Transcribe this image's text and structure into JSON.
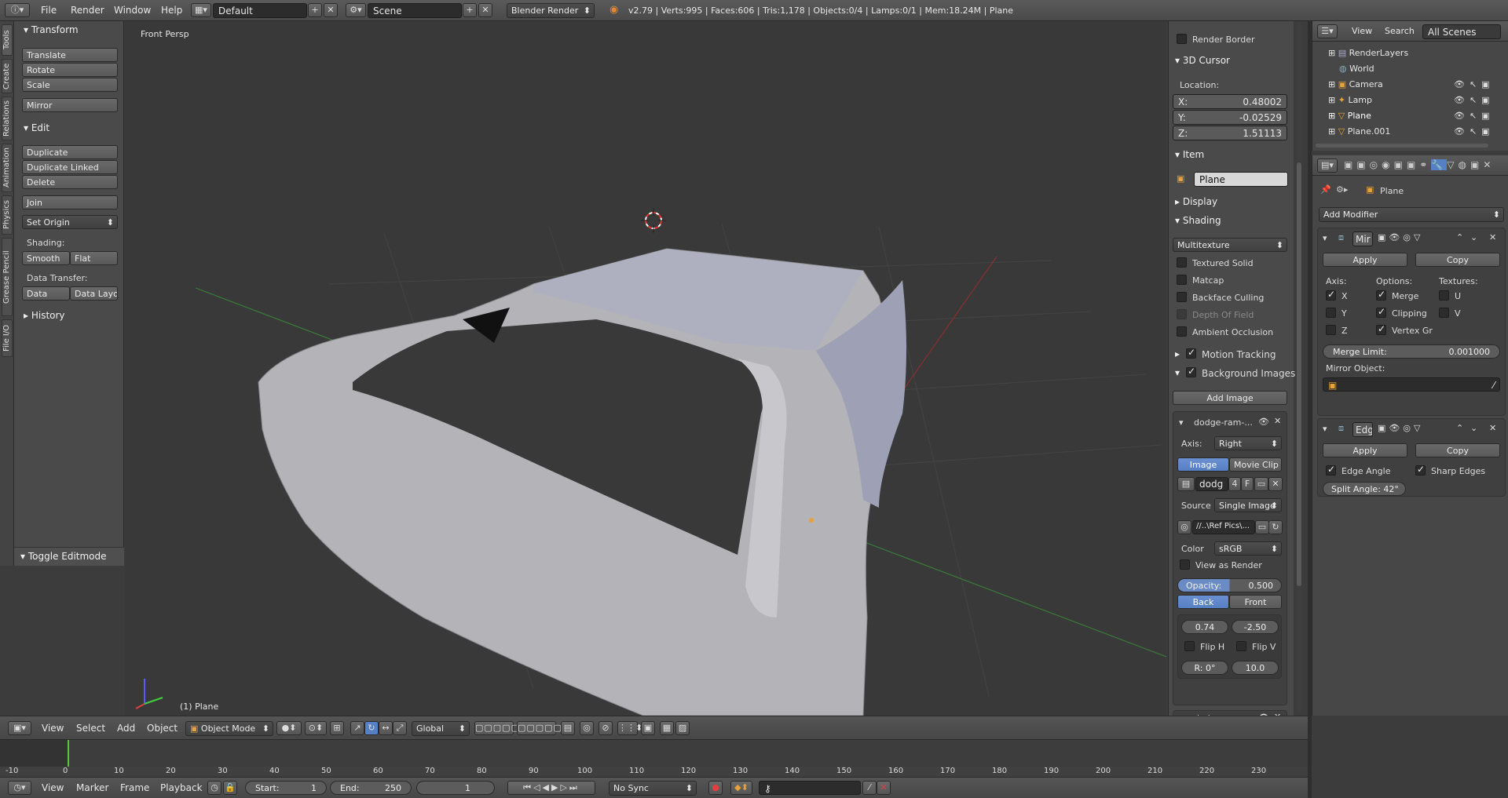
{
  "topbar": {
    "menus": [
      "File",
      "Render",
      "Window",
      "Help"
    ],
    "layout": "Default",
    "scene": "Scene",
    "engine": "Blender Render",
    "stats": "v2.79 | Verts:995 | Faces:606 | Tris:1,178 | Objects:0/4 | Lamps:0/1 | Mem:18.24M | Plane"
  },
  "tabs": [
    "Tools",
    "Create",
    "Relations",
    "Animation",
    "Physics",
    "Grease Pencil",
    "File I/O"
  ],
  "toolshelf": {
    "transform_title": "Transform",
    "translate": "Translate",
    "rotate": "Rotate",
    "scale": "Scale",
    "mirror": "Mirror",
    "edit_title": "Edit",
    "duplicate": "Duplicate",
    "duplicate_linked": "Duplicate Linked",
    "delete": "Delete",
    "join": "Join",
    "set_origin": "Set Origin",
    "shading_label": "Shading:",
    "smooth": "Smooth",
    "flat": "Flat",
    "data_transfer_label": "Data Transfer:",
    "data": "Data",
    "data_layo": "Data Layo",
    "history_title": "History",
    "toggle_editmode": "Toggle Editmode"
  },
  "viewport": {
    "view_name": "Front Persp",
    "object_label": "(1) Plane"
  },
  "npanel": {
    "render_border": "Render Border",
    "cursor_title": "3D Cursor",
    "location_label": "Location:",
    "x_label": "X:",
    "x_value": "0.48002",
    "y_label": "Y:",
    "y_value": "-0.02529",
    "z_label": "Z:",
    "z_value": "1.51113",
    "item_title": "Item",
    "item_name": "Plane",
    "display_title": "Display",
    "shading_title": "Shading",
    "shading_mode": "Multitexture",
    "textured_solid": "Textured Solid",
    "matcap": "Matcap",
    "backface_culling": "Backface Culling",
    "depth_of_field": "Depth Of Field",
    "ambient_occlusion": "Ambient Occlusion",
    "motion_tracking": "Motion Tracking",
    "background_images": "Background Images",
    "add_image": "Add Image",
    "bg1_name": "dodge-ram-...",
    "axis_label": "Axis:",
    "axis_value": "Right",
    "image_tab": "Image",
    "movie_clip_tab": "Movie Clip",
    "img_name": "dodg",
    "img_users": "4",
    "img_fake": "F",
    "source_label": "Source",
    "source_value": "Single Image",
    "filepath": "//..\\Ref Pics\\...",
    "color_label": "Color",
    "color_value": "sRGB",
    "view_as_render": "View as Render",
    "opacity_label": "Opacity:",
    "opacity_value": "0.500",
    "back": "Back",
    "front": "Front",
    "offset_x": "0.74",
    "offset_y": "-2.50",
    "flip_h": "Flip H",
    "flip_v": "Flip V",
    "rotation": "R: 0°",
    "size": "10.0",
    "bg2_name": "dodge-ram-..."
  },
  "outliner": {
    "view": "View",
    "search": "Search",
    "filter": "All Scenes",
    "rows": [
      "RenderLayers",
      "World",
      "Camera",
      "Lamp",
      "Plane",
      "Plane.001"
    ]
  },
  "props": {
    "object_name": "Plane",
    "add_modifier": "Add Modifier",
    "mod1_name": "Mir",
    "apply": "Apply",
    "copy": "Copy",
    "axis_label": "Axis:",
    "options_label": "Options:",
    "textures_label": "Textures:",
    "x": "X",
    "y": "Y",
    "z": "Z",
    "merge": "Merge",
    "clipping": "Clipping",
    "vertex_gr": "Vertex Gr",
    "u": "U",
    "v": "V",
    "merge_limit_label": "Merge Limit:",
    "merge_limit_value": "0.001000",
    "mirror_object_label": "Mirror Object:",
    "mod2_name": "Edg",
    "edge_angle": "Edge Angle",
    "sharp_edges": "Sharp Edges",
    "split_angle": "Split Angle: 42°"
  },
  "vphdr": {
    "view": "View",
    "select": "Select",
    "add": "Add",
    "object": "Object",
    "mode": "Object Mode",
    "orientation": "Global"
  },
  "timeline": {
    "ticks": [
      "-10",
      "0",
      "10",
      "20",
      "30",
      "40",
      "50",
      "60",
      "70",
      "80",
      "90",
      "100",
      "110",
      "120",
      "130",
      "140",
      "150",
      "160",
      "170",
      "180",
      "190",
      "200",
      "210",
      "220",
      "230"
    ]
  },
  "tlhdr": {
    "view": "View",
    "marker": "Marker",
    "frame": "Frame",
    "playback": "Playback",
    "start": "Start:",
    "start_value": "1",
    "end": "End:",
    "end_value": "250",
    "current": "1",
    "sync": "No Sync"
  },
  "colors": {
    "accent_blue": "#5680c4",
    "grid_green": "#3a7a3a",
    "axis_red": "#8a3030"
  }
}
